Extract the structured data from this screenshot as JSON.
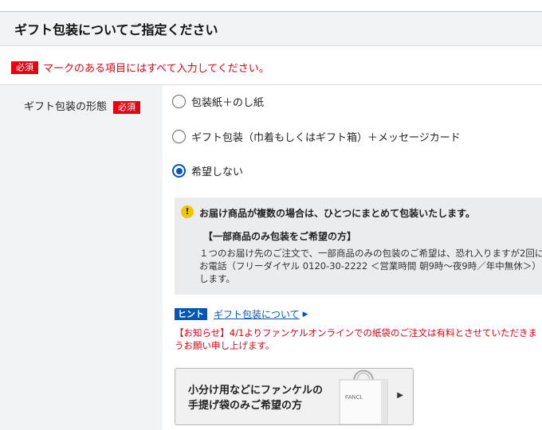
{
  "section": {
    "title": "ギフト包装についてご指定ください"
  },
  "notice": {
    "required_badge": "必須",
    "text": "マークのある項目にはすべて入力してください。"
  },
  "field": {
    "label": "ギフト包装の形態",
    "required_badge": "必須"
  },
  "options": [
    {
      "label": "包装紙＋のし紙",
      "selected": false
    },
    {
      "label": "ギフト包装（巾着もしくはギフト箱）＋メッセージカード",
      "selected": false
    },
    {
      "label": "希望しない",
      "selected": true
    }
  ],
  "info": {
    "icon": "exclamation-icon",
    "heading": "お届け商品が複数の場合は、ひとつにまとめて包装いたします。",
    "subheading": "【一部商品のみ包装をご希望の方】",
    "body_lines": [
      "１つのお届け先のご注文で、一部商品のみの包装のご希望は、恐れ入りますが2回に",
      "お電話（フリーダイヤル 0120-30-2222 ＜営業時間 朝9時～夜9時／年中無休＞）",
      "します。"
    ]
  },
  "hint": {
    "badge": "ヒント",
    "link": "ギフト包装について"
  },
  "red_notice": {
    "lines": [
      "【お知らせ】4/1よりファンケルオンラインでの紙袋のご注文は有料とさせていただきま",
      "うお願い申し上げます。"
    ]
  },
  "bag_button": {
    "line1": "小分け用などにファンケルの",
    "line2": "手提げ袋のみご希望の方",
    "bag_logo": "FANCL"
  },
  "colors": {
    "accent": "#0057b8",
    "required": "#e60012",
    "warning": "#f5c400"
  }
}
